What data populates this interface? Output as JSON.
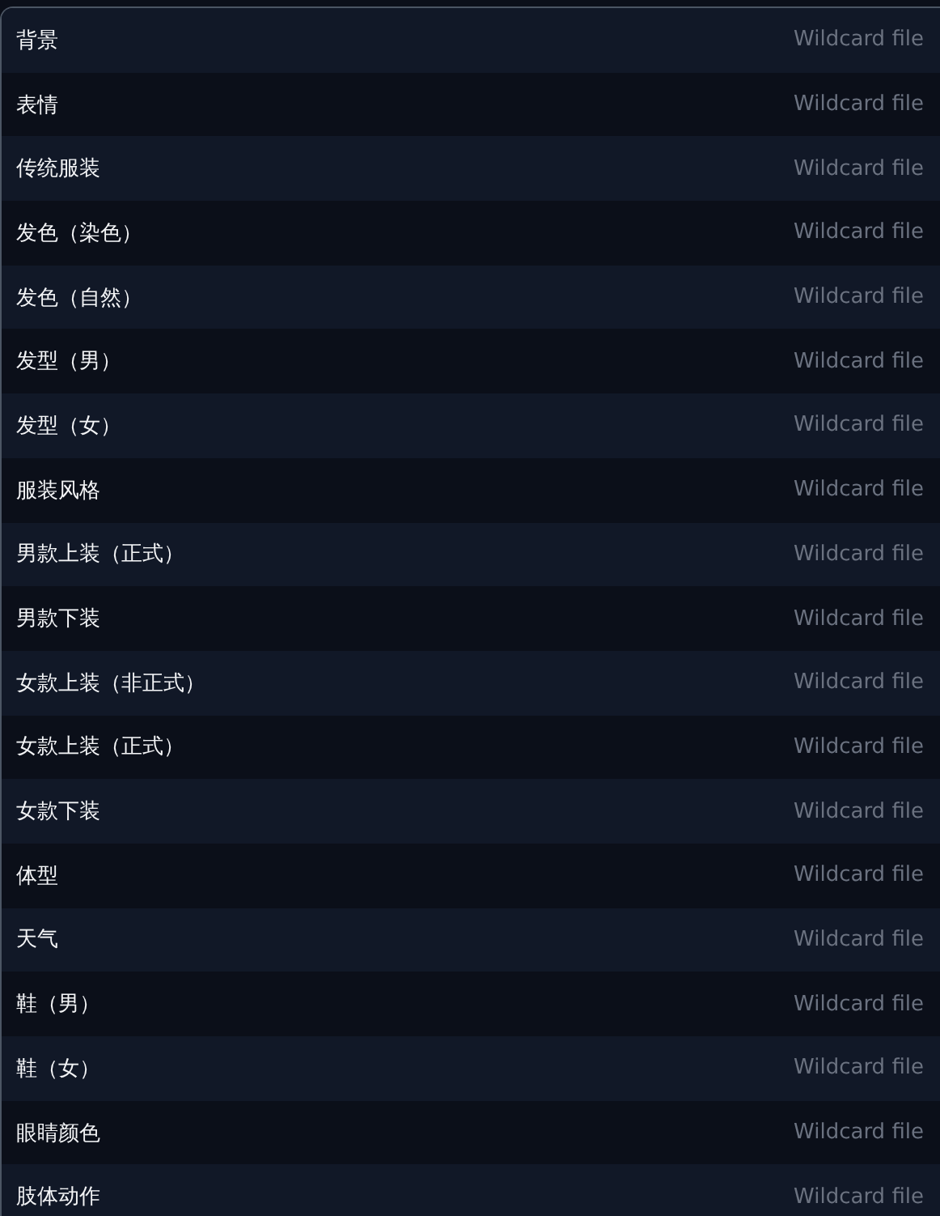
{
  "rows": [
    {
      "label": "背景",
      "type": "Wildcard file"
    },
    {
      "label": "表情",
      "type": "Wildcard file"
    },
    {
      "label": "传统服装",
      "type": "Wildcard file"
    },
    {
      "label": "发色（染色）",
      "type": "Wildcard file"
    },
    {
      "label": "发色（自然）",
      "type": "Wildcard file"
    },
    {
      "label": "发型（男）",
      "type": "Wildcard file"
    },
    {
      "label": "发型（女）",
      "type": "Wildcard file"
    },
    {
      "label": "服装风格",
      "type": "Wildcard file"
    },
    {
      "label": "男款上装（正式）",
      "type": "Wildcard file"
    },
    {
      "label": "男款下装",
      "type": "Wildcard file"
    },
    {
      "label": "女款上装（非正式）",
      "type": "Wildcard file"
    },
    {
      "label": "女款上装（正式）",
      "type": "Wildcard file"
    },
    {
      "label": "女款下装",
      "type": "Wildcard file"
    },
    {
      "label": "体型",
      "type": "Wildcard file"
    },
    {
      "label": "天气",
      "type": "Wildcard file"
    },
    {
      "label": "鞋（男）",
      "type": "Wildcard file"
    },
    {
      "label": "鞋（女）",
      "type": "Wildcard file"
    },
    {
      "label": "眼睛颜色",
      "type": "Wildcard file"
    },
    {
      "label": "肢体动作",
      "type": "Wildcard file"
    }
  ]
}
